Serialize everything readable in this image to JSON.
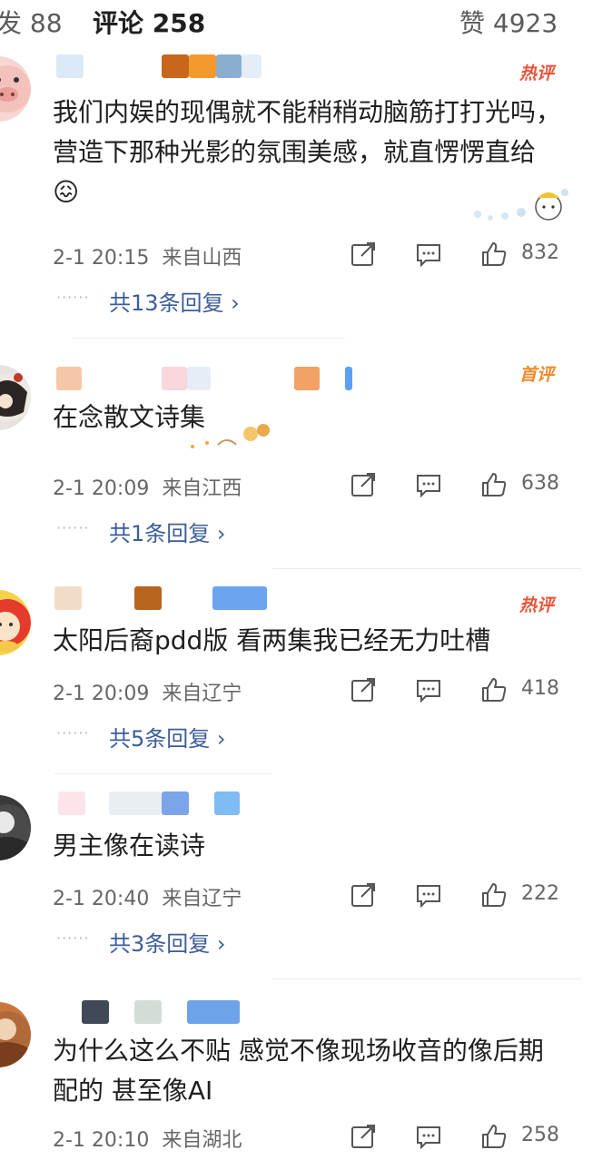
{
  "tabs": {
    "repost": "发 88",
    "comments": "评论 258",
    "likes": "赞 4923"
  },
  "comments": [
    {
      "badge": "热评",
      "text": "我们内娱的现偶就不能稍稍动脑筋打打光吗，营造下那种光影的氛围美感，就直愣愣直给😖",
      "time": "2-1 20:15",
      "location": "来自山西",
      "likes": "832",
      "replies": "共13条回复 ›"
    },
    {
      "badge": "首评",
      "text": "在念散文诗集",
      "time": "2-1 20:09",
      "location": "来自江西",
      "likes": "638",
      "replies": "共1条回复 ›"
    },
    {
      "badge": "热评",
      "text": "太阳后裔pdd版 看两集我已经无力吐槽",
      "time": "2-1 20:09",
      "location": "来自辽宁",
      "likes": "418",
      "replies": "共5条回复 ›"
    },
    {
      "badge": "",
      "text": "男主像在读诗",
      "time": "2-1 20:40",
      "location": "来自辽宁",
      "likes": "222",
      "replies": "共3条回复 ›"
    },
    {
      "badge": "",
      "text": "为什么这么不贴 感觉不像现场收音的像后期配的 甚至像AI",
      "time": "2-1 20:10",
      "location": "来自湖北",
      "likes": "258",
      "replies": ""
    }
  ],
  "icons": {
    "share": "share-icon",
    "comment": "comment-icon",
    "like": "thumbs-up-icon"
  },
  "colors": {
    "hot_badge": "#e8553a",
    "first_badge": "#f08a2c",
    "reply_link": "#3b5d9a",
    "meta_text": "#666666"
  }
}
